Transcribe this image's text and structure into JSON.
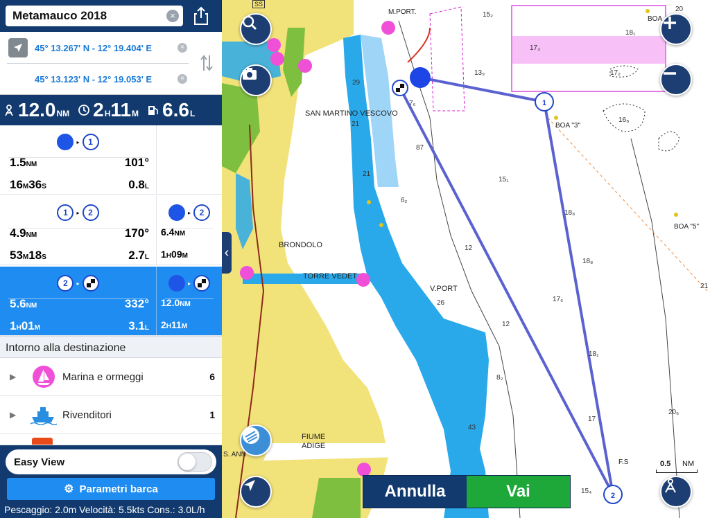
{
  "route": {
    "name": "Metamauco 2018",
    "from_coords": "45° 13.267' N - 12° 19.404' E",
    "to_coords": "45° 13.123' N - 12° 19.053' E"
  },
  "summary": {
    "distance": "12.0",
    "distance_unit": "NM",
    "time_h": "2",
    "time_h_unit": "H",
    "time_m": "11",
    "time_m_unit": "M",
    "fuel": "6.6",
    "fuel_unit": "L"
  },
  "legs": [
    {
      "from": "boat",
      "to": "1",
      "dist": "1.5",
      "dist_unit": "NM",
      "bearing": "101°",
      "time_a": "16",
      "time_a_unit": "M",
      "time_b": "36",
      "time_b_unit": "S",
      "fuel": "0.8",
      "fuel_unit": "L"
    },
    {
      "from": "1",
      "to": "2",
      "dist": "4.9",
      "dist_unit": "NM",
      "bearing": "170°",
      "time_a": "53",
      "time_a_unit": "M",
      "time_b": "18",
      "time_b_unit": "S",
      "fuel": "2.7",
      "fuel_unit": "L",
      "cum_from": "boat",
      "cum_to": "2",
      "cum_dist": "6.4",
      "cum_dist_unit": "NM",
      "cum_time_a": "1",
      "cum_time_a_unit": "H",
      "cum_time_b": "09",
      "cum_time_b_unit": "M"
    },
    {
      "from": "2",
      "to": "flag",
      "dist": "5.6",
      "dist_unit": "NM",
      "bearing": "332°",
      "time_a": "1",
      "time_a_unit": "H",
      "time_b": "01",
      "time_b_unit": "M",
      "fuel": "3.1",
      "fuel_unit": "L",
      "cum_from": "boat",
      "cum_to": "flag",
      "cum_dist": "12.0",
      "cum_dist_unit": "NM",
      "cum_time_a": "2",
      "cum_time_a_unit": "H",
      "cum_time_b": "11",
      "cum_time_b_unit": "M"
    }
  ],
  "nearby": {
    "header": "Intorno alla destinazione",
    "items": [
      {
        "label": "Marina e ormeggi",
        "count": "6",
        "icon": "sailboat-icon"
      },
      {
        "label": "Rivenditori",
        "count": "1",
        "icon": "ship-icon"
      }
    ]
  },
  "footer": {
    "easy_view_label": "Easy View",
    "easy_view_on": false,
    "boat_params_label": "Parametri barca",
    "boat_info": "Pescaggio: 2.0m Velocità: 5.5kts Cons.: 3.0L/h"
  },
  "map": {
    "labels": {
      "san_martino": "SAN MARTINO VESCOVO",
      "brondolo": "BRONDOLO",
      "torre": "TORRE VEDET",
      "vport": "V.PORT",
      "fiume": "FIUME",
      "adige": "ADIGE",
      "mport": "M.PORT.",
      "boa3": "BOA \"3\"",
      "boa5": "BOA \"5\"",
      "boa_top": "BOA",
      "fs": "F.S",
      "s_ann": "S. ANN",
      "ss": "SS"
    },
    "depths": [
      "15₂",
      "18₁",
      "17₃",
      "13₉",
      "29",
      "7₆",
      "21",
      "87",
      "15₁",
      "18₈",
      "21",
      "6₂",
      "12",
      "18₈",
      "17₆",
      "V.PORT",
      "26",
      "12",
      "18₁",
      "8₂",
      "43",
      "17",
      "20₅",
      "15₄",
      "20",
      "21",
      "16₈",
      "17₂"
    ],
    "scale_label": "0.5",
    "scale_unit": "NM",
    "cancel_label": "Annulla",
    "go_label": "Vai",
    "colors": {
      "land": "#f2e27a",
      "shallow": "#2aa9ea",
      "shallow_light": "#9fd5f7",
      "green": "#7fbf3f",
      "route": "#5b62d0"
    }
  }
}
